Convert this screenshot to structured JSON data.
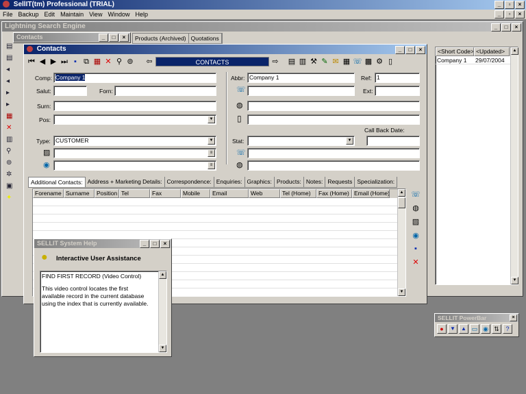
{
  "app": {
    "title": "SellIT(tm) Professional (TRIAL)"
  },
  "menu": [
    "File",
    "Backup",
    "Edit",
    "Maintain",
    "View",
    "Window",
    "Help"
  ],
  "lse": {
    "title": "Lightning Search Engine"
  },
  "bg_tabs": [
    "Products (Archived)",
    "Quotations"
  ],
  "right_grid": {
    "headers": [
      "<Short Code>",
      "<Updated>"
    ],
    "row": [
      "Company 1",
      "29/07/2004"
    ]
  },
  "contacts_bg": {
    "title": "Contacts"
  },
  "contacts": {
    "title": "Contacts",
    "nav_label": "CONTACTS",
    "labels": {
      "comp": "Comp:",
      "salut": "Salut:",
      "forn": "Forn:",
      "surn": "Surn:",
      "pos": "Pos:",
      "type": "Type:",
      "abbr": "Abbr:",
      "ref": "Ref:",
      "ext": "Ext:",
      "callback": "Call Back Date:",
      "stat": "Stat:"
    },
    "values": {
      "comp": "Company 1",
      "abbr": "Company 1",
      "ref": "1",
      "type": "CUSTOMER"
    }
  },
  "tabs": [
    "Additional Contacts:",
    "Address + Marketing Details:",
    "Correspondence:",
    "Enquiries:",
    "Graphics:",
    "Products:",
    "Notes:",
    "Requests",
    "Specialization:"
  ],
  "grid_headers": [
    "Forename",
    "Surname",
    "Position",
    "Tel",
    "Fax",
    "Mobile",
    "Email",
    "Web",
    "Tel (Home)",
    "Fax (Home)",
    "Email (Home)"
  ],
  "help": {
    "title": "SELLIT System Help",
    "heading": "Interactive User Assistance",
    "item": "FIND FIRST RECORD (Video Control)",
    "body": "This video control locates the first available record in the current database using the index that is currently available."
  },
  "powerbar": {
    "title": "SELLIT PowerBar"
  }
}
